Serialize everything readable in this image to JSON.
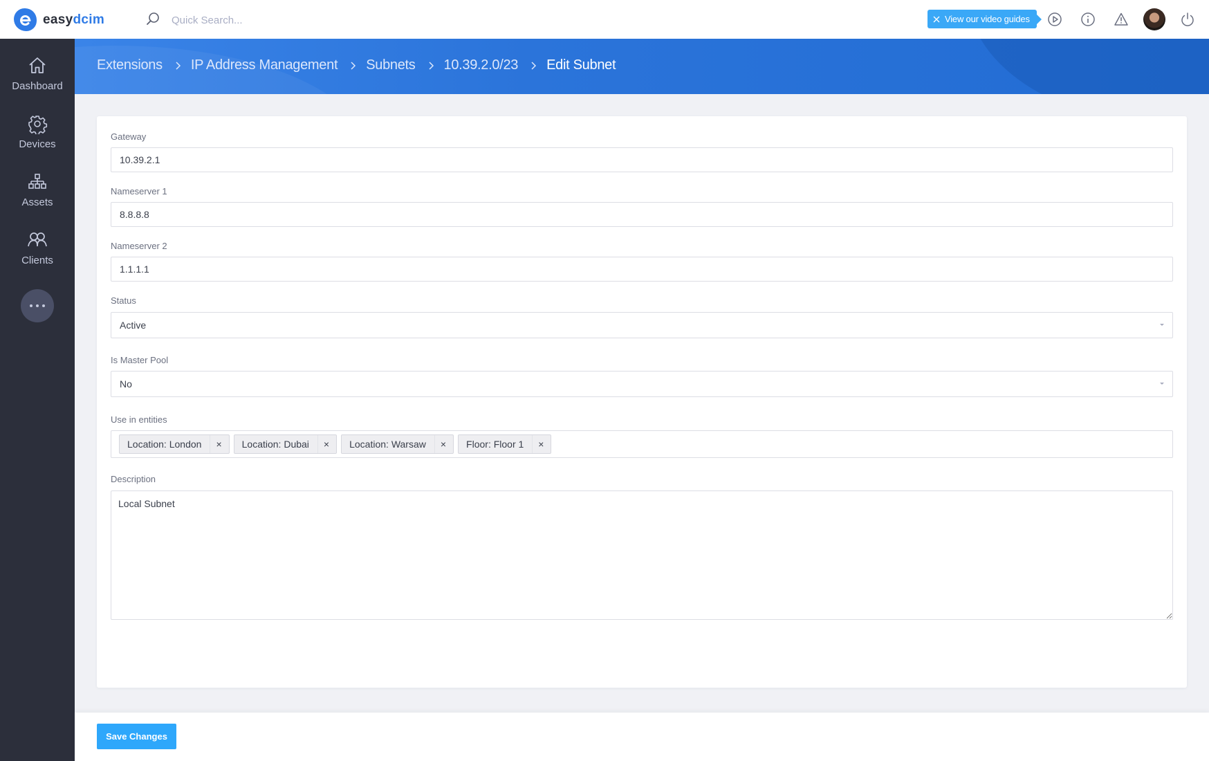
{
  "app": {
    "logo_part1": "easy",
    "logo_part2": "dcim",
    "brand_color": "#2f7be6"
  },
  "header": {
    "search_placeholder": "Quick Search...",
    "video_guides_label": "View our video guides",
    "icons": [
      "play-circle-icon",
      "info-icon",
      "warning-icon",
      "avatar",
      "power-icon"
    ]
  },
  "sidebar": {
    "items": [
      {
        "label": "Dashboard",
        "icon": "home-icon"
      },
      {
        "label": "Devices",
        "icon": "gear-icon"
      },
      {
        "label": "Assets",
        "icon": "hierarchy-icon"
      },
      {
        "label": "Clients",
        "icon": "users-icon"
      }
    ],
    "more_icon": "more-icon"
  },
  "breadcrumb": {
    "items": [
      "Extensions",
      "IP Address Management",
      "Subnets",
      "10.39.2.0/23"
    ],
    "current": "Edit Subnet"
  },
  "form": {
    "gateway": {
      "label": "Gateway",
      "value": "10.39.2.1"
    },
    "nameserver1": {
      "label": "Nameserver 1",
      "value": "8.8.8.8"
    },
    "nameserver2": {
      "label": "Nameserver 2",
      "value": "1.1.1.1"
    },
    "status": {
      "label": "Status",
      "value": "Active"
    },
    "master_pool": {
      "label": "Is Master Pool",
      "value": "No"
    },
    "entities": {
      "label": "Use in entities",
      "tags": [
        "Location: London",
        "Location: Dubai",
        "Location: Warsaw",
        "Floor: Floor 1"
      ],
      "remove_glyph": "×"
    },
    "description": {
      "label": "Description",
      "value": "Local Subnet"
    }
  },
  "footer": {
    "save_label": "Save Changes"
  }
}
